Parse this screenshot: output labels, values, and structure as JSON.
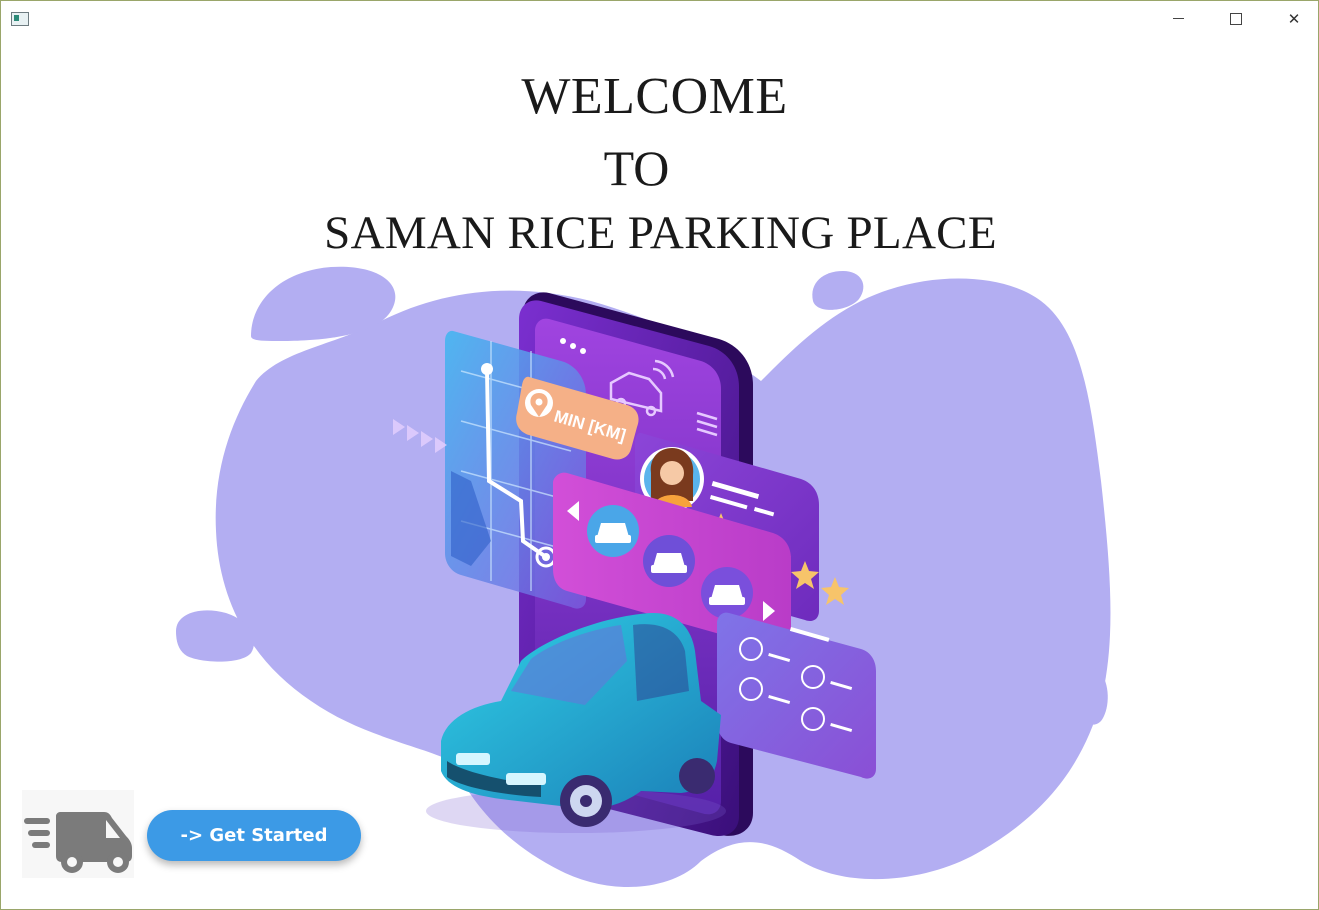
{
  "window": {
    "icon": "app-window-icon",
    "controls": {
      "minimize": "─",
      "maximize": "☐",
      "close": "✕"
    }
  },
  "headline": {
    "line1": "WELCOME",
    "line2": "TO",
    "line3": "SAMAN RICE PARKING PLACE"
  },
  "illustration": {
    "badge_text": "MIN [KM]",
    "colors": {
      "blob": "#b3aef2",
      "phone": "#5b1fa6",
      "panel": "#7a37c7",
      "car": "#1db8d6",
      "badge": "#f5b087",
      "star": "#f7c46a"
    }
  },
  "actions": {
    "get_started_label": "-> Get Started",
    "van_icon": "delivery-van-icon"
  }
}
